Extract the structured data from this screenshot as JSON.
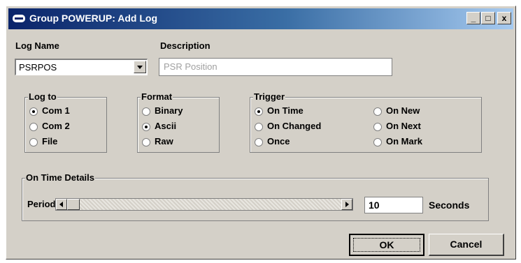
{
  "window": {
    "title": "Group POWERUP: Add Log",
    "min_glyph": "_",
    "max_glyph": "□",
    "close_glyph": "x"
  },
  "log_name": {
    "label": "Log Name",
    "value": "PSRPOS"
  },
  "description": {
    "label": "Description",
    "value": "PSR Position"
  },
  "log_to": {
    "label": "Log to",
    "options": [
      "Com 1",
      "Com 2",
      "File"
    ],
    "selected": "Com 1"
  },
  "format": {
    "label": "Format",
    "options": [
      "Binary",
      "Ascii",
      "Raw"
    ],
    "selected": "Ascii"
  },
  "trigger": {
    "label": "Trigger",
    "options": [
      "On Time",
      "On Changed",
      "Once",
      "On New",
      "On Next",
      "On Mark"
    ],
    "selected": "On Time"
  },
  "on_time_details": {
    "label": "On Time Details",
    "period_label": "Period:",
    "period_value": "10",
    "unit": "Seconds"
  },
  "buttons": {
    "ok": "OK",
    "cancel": "Cancel"
  }
}
